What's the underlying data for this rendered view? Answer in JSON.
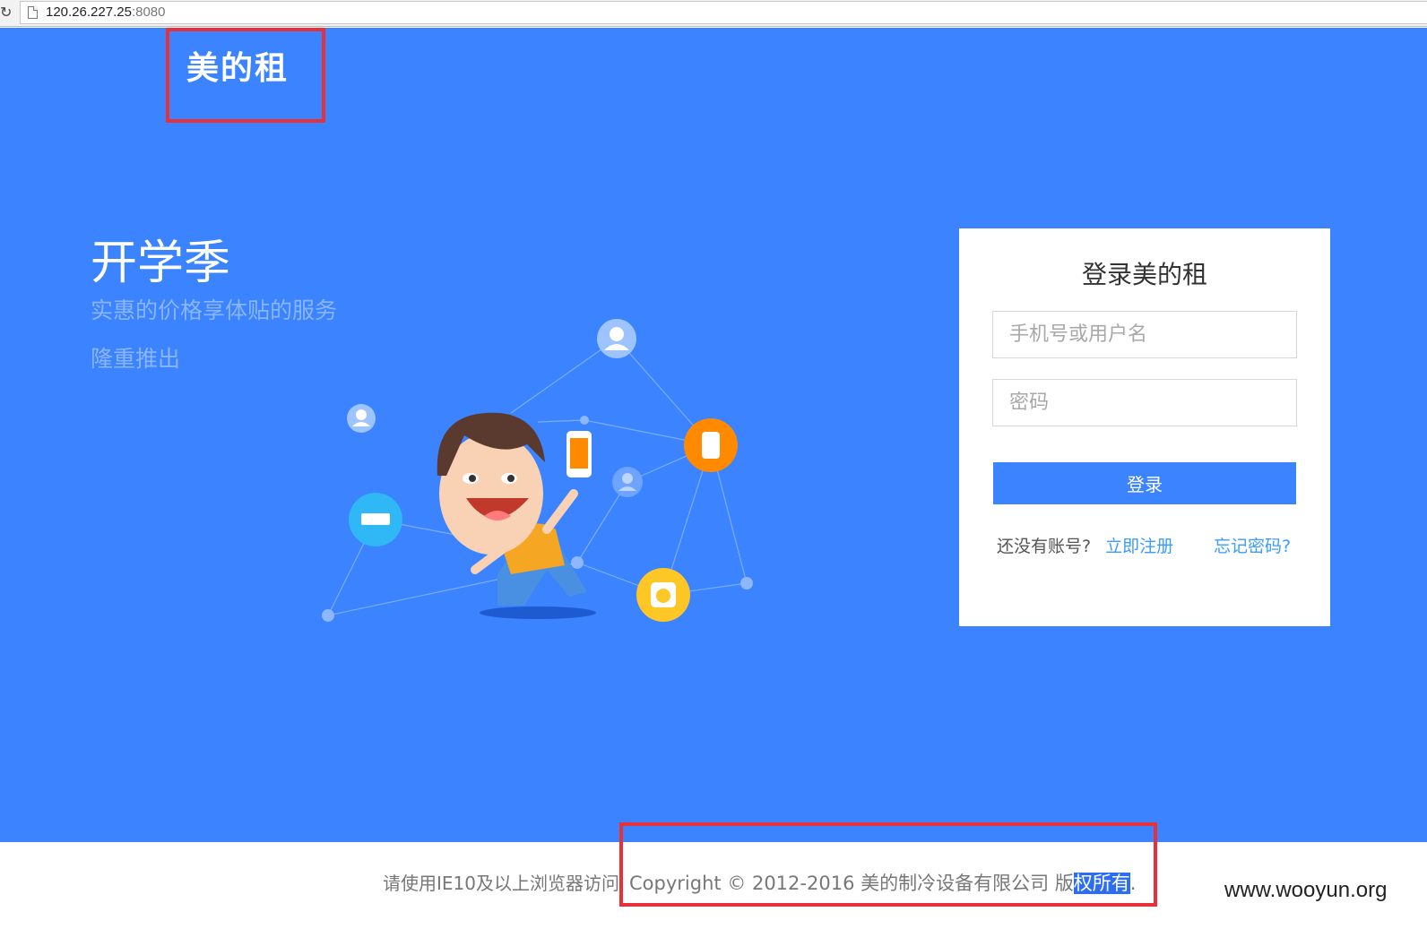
{
  "browser": {
    "url_host": "120.26.227.25",
    "url_port": ":8080"
  },
  "header": {
    "logo": "美的租"
  },
  "hero": {
    "title": "开学季",
    "subtitle_1": "实惠的价格享体贴的服务",
    "subtitle_2": "隆重推出"
  },
  "login": {
    "title": "登录美的租",
    "username_placeholder": "手机号或用户名",
    "password_placeholder": "密码",
    "submit_label": "登录",
    "no_account_text": "还没有账号?",
    "register_link": "立即注册",
    "forgot_link": "忘记密码?"
  },
  "footer": {
    "browser_note": "请使用IE10及以上浏览器访问",
    "copyright_main": "Copyright © 2012-2016 美的制冷设备有限公司 版",
    "copyright_selected": "权所有",
    "copyright_end": "."
  },
  "watermark": "www.wooyun.org",
  "colors": {
    "brand_blue": "#3b83ff",
    "highlight_red": "#e8303a",
    "link_blue": "#3b9cff"
  }
}
